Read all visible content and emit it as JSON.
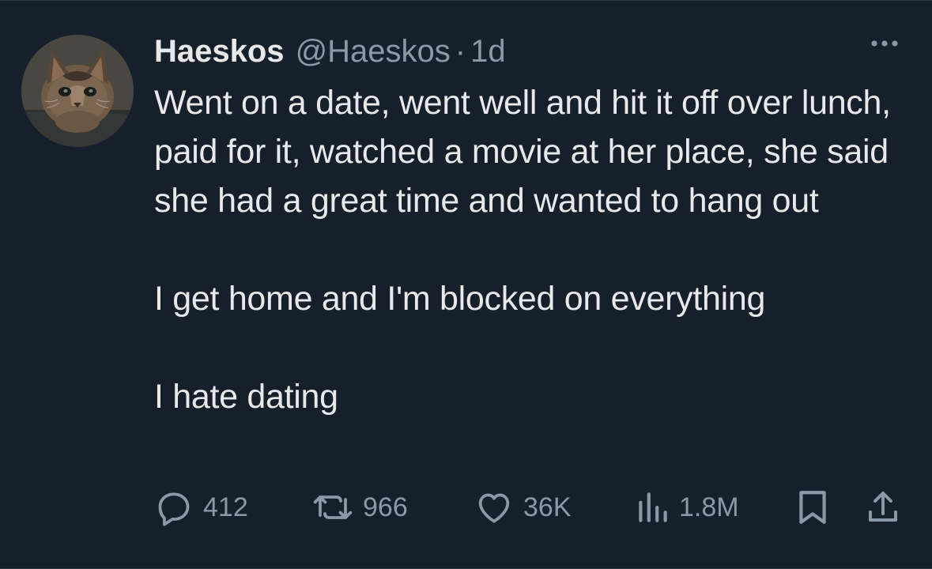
{
  "tweet": {
    "author": {
      "display_name": "Haeskos",
      "handle": "@Haeskos",
      "avatar_icon": "cat-avatar"
    },
    "separator": "·",
    "time": "1d",
    "paragraphs": [
      "Went on a date, went well and hit it off over lunch, paid for it, watched a movie at her place, she said she had a great time and wanted to hang out",
      "I get home and I'm blocked on everything",
      "I hate dating"
    ],
    "stats": {
      "replies": "412",
      "reposts": "966",
      "likes": "36K",
      "views": "1.8M"
    },
    "icons": {
      "more": "more-icon",
      "reply": "reply-icon",
      "repost": "repost-icon",
      "like": "like-icon",
      "views": "views-icon",
      "bookmark": "bookmark-icon",
      "share": "share-icon"
    },
    "colors": {
      "background": "#15202b",
      "text": "#e7e9ea",
      "muted": "#8b98a5"
    }
  }
}
